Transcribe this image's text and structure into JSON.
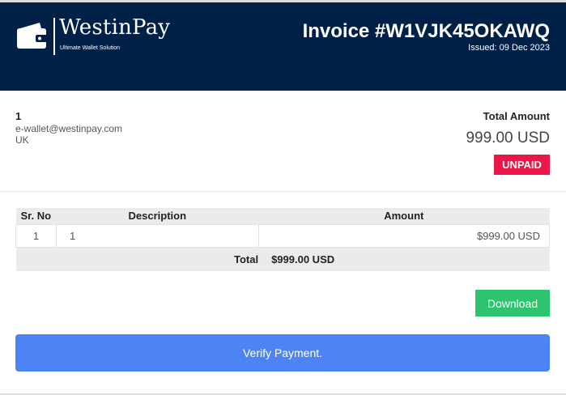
{
  "brand": {
    "name": "WestinPay",
    "tagline": "Ultimate Wallet Solution",
    "icon": "wallet-icon"
  },
  "invoice": {
    "title": "Invoice #W1VJK45OKAWQ",
    "issued_label": "Issued:",
    "issued_date": "09 Dec 2023"
  },
  "customer": {
    "name": "1",
    "email": "e-wallet@westinpay.com",
    "country": "UK"
  },
  "summary": {
    "total_label": "Total Amount",
    "total_amount": "999.00 USD",
    "status": "UNPAID"
  },
  "table": {
    "headers": {
      "sr_no": "Sr. No",
      "description": "Description",
      "amount": "Amount"
    },
    "rows": [
      {
        "sr_no": "1",
        "description": "1",
        "amount": "$999.00 USD"
      }
    ],
    "total_label": "Total",
    "total_value": "$999.00 USD"
  },
  "actions": {
    "download_label": "Download",
    "verify_label": "Verify Payment."
  },
  "colors": {
    "header_bg": "#002147",
    "status_unpaid": "#eb1746",
    "download_green": "#2ec46f",
    "verify_blue": "#4d84f5"
  }
}
